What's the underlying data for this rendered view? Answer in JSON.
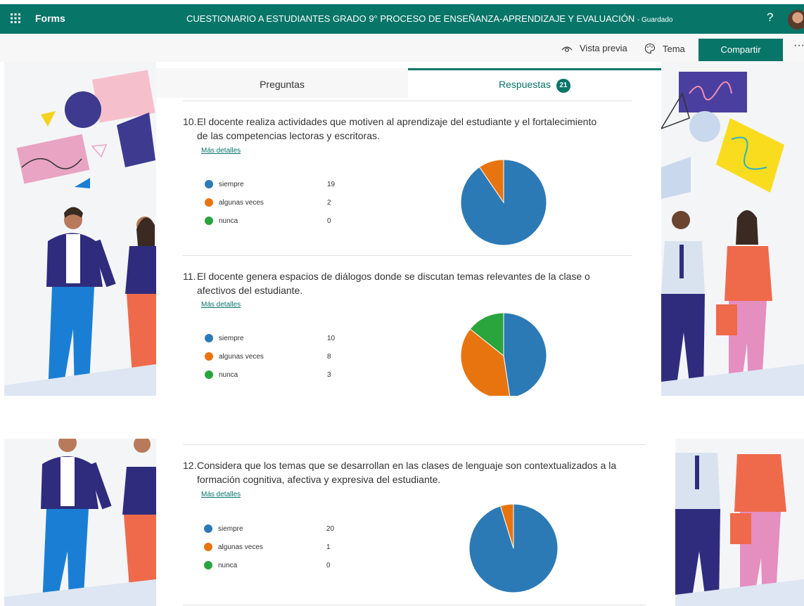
{
  "topbar": {
    "brand": "Forms",
    "title": "CUESTIONARIO A ESTUDIANTES GRADO 9° PROCESO DE ENSEÑANZA-APRENDIZAJE Y EVALUACIÓN",
    "status": "- Guardado",
    "help": "?"
  },
  "commands": {
    "preview": "Vista previa",
    "theme": "Tema",
    "share": "Compartir",
    "more": "···"
  },
  "tabs": {
    "questions": "Preguntas",
    "responses": "Respuestas",
    "responses_count": "21"
  },
  "colors": {
    "brand": "#077568",
    "siempre": "#2c7ab5",
    "algunas": "#e8740f",
    "nunca": "#2aa43c"
  },
  "icons": [
    "waffle-icon",
    "help-icon",
    "avatar",
    "eye-icon",
    "palette-icon",
    "more-icon"
  ],
  "questions": [
    {
      "number": "10.",
      "line1": "El docente realiza actividades que motiven al aprendizaje del estudiante y el fortalecimiento",
      "line2": "de las competencias lectoras y escritoras.",
      "details": "Más detalles",
      "options": [
        {
          "label": "siempre",
          "count": "19",
          "value": 19
        },
        {
          "label": "algunas veces",
          "count": "2",
          "value": 2
        },
        {
          "label": "nunca",
          "count": "0",
          "value": 0
        }
      ]
    },
    {
      "number": "11.",
      "line1": "El docente genera espacios de diálogos donde se discutan temas relevantes de la clase o",
      "line2": "afectivos del estudiante.",
      "details": "Más detalles",
      "options": [
        {
          "label": "siempre",
          "count": "10",
          "value": 10
        },
        {
          "label": "algunas veces",
          "count": "8",
          "value": 8
        },
        {
          "label": "nunca",
          "count": "3",
          "value": 3
        }
      ]
    },
    {
      "number": "12.",
      "line1": "Considera que los temas que se desarrollan en las clases de lenguaje son contextualizados a la",
      "line2": "formación cognitiva, afectiva y expresiva del estudiante.",
      "details": "Más detalles",
      "options": [
        {
          "label": "siempre",
          "count": "20",
          "value": 20
        },
        {
          "label": "algunas veces",
          "count": "1",
          "value": 1
        },
        {
          "label": "nunca",
          "count": "0",
          "value": 0
        }
      ]
    }
  ]
}
